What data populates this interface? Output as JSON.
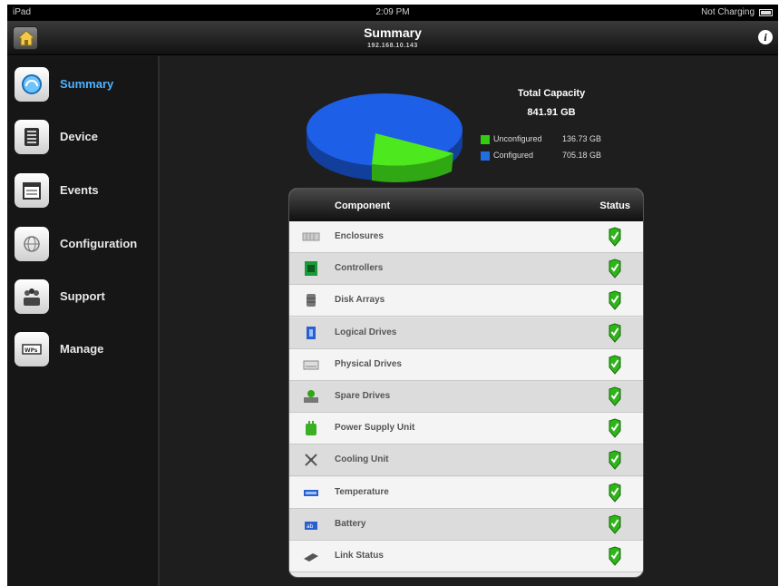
{
  "status_bar": {
    "carrier": "iPad",
    "time": "2:09 PM",
    "charge": "Not Charging"
  },
  "nav": {
    "title": "Summary",
    "subtitle": "192.168.10.143",
    "info_icon": "info-icon",
    "home_icon": "home-icon"
  },
  "sidebar": {
    "items": [
      {
        "label": "Summary",
        "icon": "summary-icon",
        "active": true
      },
      {
        "label": "Device",
        "icon": "device-icon"
      },
      {
        "label": "Events",
        "icon": "events-icon"
      },
      {
        "label": "Configuration",
        "icon": "globe-icon"
      },
      {
        "label": "Support",
        "icon": "support-icon"
      },
      {
        "label": "Manage",
        "icon": "manage-icon"
      }
    ]
  },
  "capacity": {
    "title": "Total Capacity",
    "value": "841.91 GB",
    "legend": [
      {
        "label": "Unconfigured",
        "value": "136.73 GB",
        "color": "#33cc11"
      },
      {
        "label": "Configured",
        "value": "705.18 GB",
        "color": "#1f6fe0"
      }
    ]
  },
  "table": {
    "col_component": "Component",
    "col_status": "Status",
    "rows": [
      {
        "label": "Enclosures",
        "icon": "enclosure-icon",
        "status": "ok"
      },
      {
        "label": "Controllers",
        "icon": "controller-icon",
        "status": "ok"
      },
      {
        "label": "Disk Arrays",
        "icon": "disk-array-icon",
        "status": "ok"
      },
      {
        "label": "Logical Drives",
        "icon": "logical-drive-icon",
        "status": "ok"
      },
      {
        "label": "Physical Drives",
        "icon": "physical-drive-icon",
        "status": "ok"
      },
      {
        "label": "Spare Drives",
        "icon": "spare-drive-icon",
        "status": "ok"
      },
      {
        "label": "Power Supply Unit",
        "icon": "power-supply-icon",
        "status": "ok"
      },
      {
        "label": "Cooling Unit",
        "icon": "fan-icon",
        "status": "ok"
      },
      {
        "label": "Temperature",
        "icon": "temperature-icon",
        "status": "ok"
      },
      {
        "label": "Battery",
        "icon": "battery-icon",
        "status": "ok"
      },
      {
        "label": "Link Status",
        "icon": "link-icon",
        "status": "ok"
      }
    ]
  }
}
